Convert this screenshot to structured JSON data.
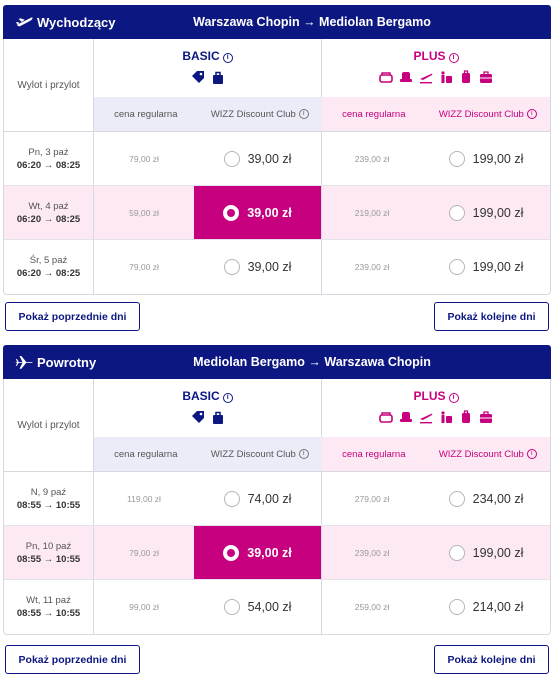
{
  "colors": {
    "navy": "#0c1781",
    "magenta": "#c6007e"
  },
  "labels": {
    "flight_time": "Wylot i przylot",
    "basic": "BASIC",
    "plus": "PLUS",
    "info_glyph": "i",
    "regular_price": "cena regularna",
    "wdc_price": "WIZZ Discount Club",
    "prev_days": "Pokaż poprzednie dni",
    "next_days": "Pokaż kolejne dni"
  },
  "icons": {
    "basic": [
      "tag-icon",
      "small-bag-icon"
    ],
    "plus": [
      "seat-icon",
      "priority-seat-icon",
      "check-in-icon",
      "baggage-icon",
      "trolley-icon",
      "suitcase-icon"
    ]
  },
  "outbound": {
    "direction": "Wychodzący",
    "route": "Warszawa Chopin → Mediolan Bergamo",
    "rows": [
      {
        "day": "Pn, 3 paź",
        "time": "06:20 → 08:25",
        "basic_regular": "79,00 zł",
        "basic_club": "39,00 zł",
        "plus_regular": "239,00 zł",
        "plus_club": "199,00 zł",
        "selected": false
      },
      {
        "day": "Wt, 4 paź",
        "time": "06:20 → 08:25",
        "basic_regular": "59,00 zł",
        "basic_club": "39,00 zł",
        "plus_regular": "219,00 zł",
        "plus_club": "199,00 zł",
        "selected": true
      },
      {
        "day": "Śr, 5 paź",
        "time": "06:20 → 08:25",
        "basic_regular": "79,00 zł",
        "basic_club": "39,00 zł",
        "plus_regular": "239,00 zł",
        "plus_club": "199,00 zł",
        "selected": false
      }
    ]
  },
  "return": {
    "direction": "Powrotny",
    "route": "Mediolan Bergamo → Warszawa Chopin",
    "rows": [
      {
        "day": "N, 9 paź",
        "time": "08:55 → 10:55",
        "basic_regular": "119,00 zł",
        "basic_club": "74,00 zł",
        "plus_regular": "279,00 zł",
        "plus_club": "234,00 zł",
        "selected": false
      },
      {
        "day": "Pn, 10 paź",
        "time": "08:55 → 10:55",
        "basic_regular": "79,00 zł",
        "basic_club": "39,00 zł",
        "plus_regular": "239,00 zł",
        "plus_club": "199,00 zł",
        "selected": true
      },
      {
        "day": "Wt, 11 paź",
        "time": "08:55 → 10:55",
        "basic_regular": "99,00 zł",
        "basic_club": "54,00 zł",
        "plus_regular": "259,00 zł",
        "plus_club": "214,00 zł",
        "selected": false
      }
    ]
  }
}
